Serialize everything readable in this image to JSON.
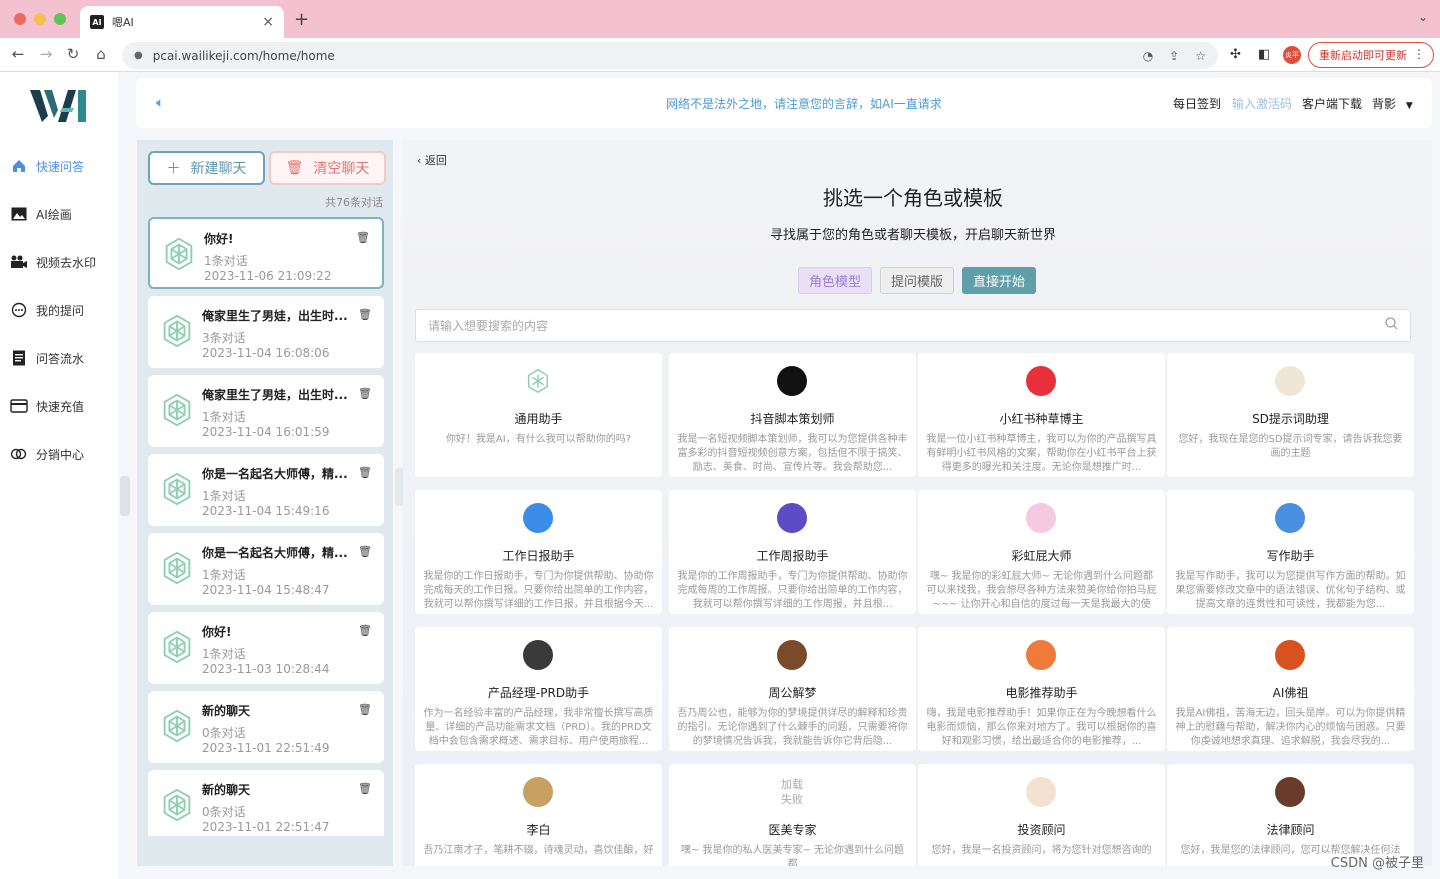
{
  "browser": {
    "tab_title": "嗯AI",
    "tab_favicon": "AI",
    "url": "pcai.wailikeji.com/home/home",
    "restart_label": "重新启动即可更新",
    "profile_label": "炎平"
  },
  "logo_text": "WAI",
  "nav": {
    "items": [
      {
        "label": "快速问答",
        "icon": "home-icon"
      },
      {
        "label": "AI绘画",
        "icon": "image-icon"
      },
      {
        "label": "视频去水印",
        "icon": "camera-icon"
      },
      {
        "label": "我的提问",
        "icon": "chat-bubble-icon"
      },
      {
        "label": "问答流水",
        "icon": "receipt-icon"
      },
      {
        "label": "快速充值",
        "icon": "card-icon"
      },
      {
        "label": "分销中心",
        "icon": "share-icon"
      }
    ]
  },
  "topbar": {
    "notice": "网络不是法外之地，请注意您的言辞，如AI一直请求",
    "daily_signin": "每日签到",
    "activation_code": "输入激活码",
    "client_download": "客户端下载",
    "background": "背影"
  },
  "chatpanel": {
    "new_chat": "新建聊天",
    "clear_chat": "清空聊天",
    "total": "共76条对话",
    "chats": [
      {
        "title": "你好!",
        "count": "1条对话",
        "time": "2023-11-06 21:09:22"
      },
      {
        "title": "俺家里生了男娃，出生时...",
        "count": "3条对话",
        "time": "2023-11-04 16:08:06"
      },
      {
        "title": "俺家里生了男娃，出生时...",
        "count": "1条对话",
        "time": "2023-11-04 16:01:59"
      },
      {
        "title": "你是一名起名大师傅，精...",
        "count": "1条对话",
        "time": "2023-11-04 15:49:16"
      },
      {
        "title": "你是一名起名大师傅，精...",
        "count": "1条对话",
        "time": "2023-11-04 15:48:47"
      },
      {
        "title": "你好!",
        "count": "1条对话",
        "time": "2023-11-03 10:28:44"
      },
      {
        "title": "新的聊天",
        "count": "0条对话",
        "time": "2023-11-01 22:51:49"
      },
      {
        "title": "新的聊天",
        "count": "0条对话",
        "time": "2023-11-01 22:51:47"
      }
    ]
  },
  "main": {
    "back": "返回",
    "title": "挑选一个角色或模板",
    "subtitle": "寻找属于您的角色或者聊天模板，开启聊天新世界",
    "segments": [
      "角色模型",
      "提问模版",
      "直接开始"
    ],
    "search_placeholder": "请输入想要搜索的内容",
    "cards": [
      {
        "name": "通用助手",
        "desc": "你好！我是AI，有什么我可以帮助你的吗?",
        "icon": "chatgpt-logo-icon",
        "color": "#ffffff"
      },
      {
        "name": "抖音脚本策划师",
        "desc": "我是一名短视频脚本策划师，我可以为您提供各种丰富多彩的抖音短视频创意方案，包括但不限于搞笑、励志、美食、时尚、宣传片等。我会帮助您...",
        "icon": "douyin-icon",
        "color": "#111111"
      },
      {
        "name": "小红书种草博主",
        "desc": "我是一位小红书种草博主，我可以为你的产品撰写具有鲜明小红书风格的文案，帮助你在小红书平台上获得更多的曝光和关注度。无论你是想推广时...",
        "icon": "xiaohongshu-icon",
        "color": "#e8303c"
      },
      {
        "name": "SD提示词助理",
        "desc": "您好，我现在是您的SD提示词专家，请告诉我您要画的主题",
        "icon": "avatar-boy-icon",
        "color": "#f0e6d8"
      },
      {
        "name": "工作日报助手",
        "desc": "我是你的工作日报助手，专门为你提供帮助、协助你完成每天的工作日报。只要你给出简单的工作内容，我就可以帮你撰写详细的工作日报，并且根据今天...",
        "icon": "daily-report-icon",
        "color": "#3b8de8"
      },
      {
        "name": "工作周报助手",
        "desc": "我是你的工作周报助手，专门为你提供帮助、协助你完成每周的工作周报。只要你给出简单的工作内容，我就可以帮你撰写详细的工作周报，并且根...",
        "icon": "weekly-report-icon",
        "color": "#5b4bc4"
      },
      {
        "name": "彩虹屁大师",
        "desc": "嘿~ 我是你的彩虹屁大师~ 无论你遇到什么问题都可以来找我，我会想尽各种方法来赞美你给你拍马屁~~~ 让你开心和自信的度过每一天是我最大的使命...",
        "icon": "avatar-girl-icon",
        "color": "#f5c9e0"
      },
      {
        "name": "写作助手",
        "desc": "我是写作助手，我可以为您提供写作方面的帮助。如果您需要修改文章中的语法错误、优化句子结构、或提高文章的连贯性和可读性，我都能为您...",
        "icon": "writing-icon",
        "color": "#4a8fe0"
      },
      {
        "name": "产品经理-PRD助手",
        "desc": "作为一名经验丰富的产品经理，我非常擅长撰写高质量、详细的产品功能需求文档（PRD）。我的PRD文档中会包含需求概述、需求目标、用户使用旅程...",
        "icon": "avatar-man-icon",
        "color": "#3a3a3a"
      },
      {
        "name": "周公解梦",
        "desc": "吾乃周公也，能够为你的梦境提供详尽的解释和珍贵的指引。无论你遇到了什么棘手的问题，只需要将你的梦境情况告诉我，我就能告诉你它背后隐...",
        "icon": "dream-icon",
        "color": "#7a4a2a"
      },
      {
        "name": "电影推荐助手",
        "desc": "嗨，我是电影推荐助手！如果你正在为今晚想看什么电影而烦恼，那么你来对地方了。我可以根据你的喜好和观影习惯，给出最适合你的电影推荐，...",
        "icon": "clapper-icon",
        "color": "#f07a3a"
      },
      {
        "name": "AI佛祖",
        "desc": "我是AI佛祖，苦海无边，回头是岸。可以为你提供精神上的慰藉与帮助，解决你内心的烦恼与困惑。只要你虔诚地想求真理、追求解脱，我会尽我的...",
        "icon": "buddha-icon",
        "color": "#d8521f"
      },
      {
        "name": "李白",
        "desc": "吾乃江南才子，笔耕不辍，诗魂灵动，喜饮佳酿，好",
        "icon": "poet-icon",
        "color": "#c8a060"
      },
      {
        "name": "医美专家",
        "desc": "嘿~ 我是你的私人医美专家~ 无论你遇到什么问题都",
        "icon": "loading-icon",
        "color": "#ffffff",
        "placeholder": "加载\n失败"
      },
      {
        "name": "投资顾问",
        "desc": "您好，我是一名投资顾问，将为您针对您想咨询的",
        "icon": "investor-icon",
        "color": "#f3e2d0"
      },
      {
        "name": "法律顾问",
        "desc": "您好，我是您的法律顾问，您可以帮您解决任何法",
        "icon": "lawyer-icon",
        "color": "#6a3a2a"
      }
    ]
  },
  "watermark": "CSDN @被子里"
}
